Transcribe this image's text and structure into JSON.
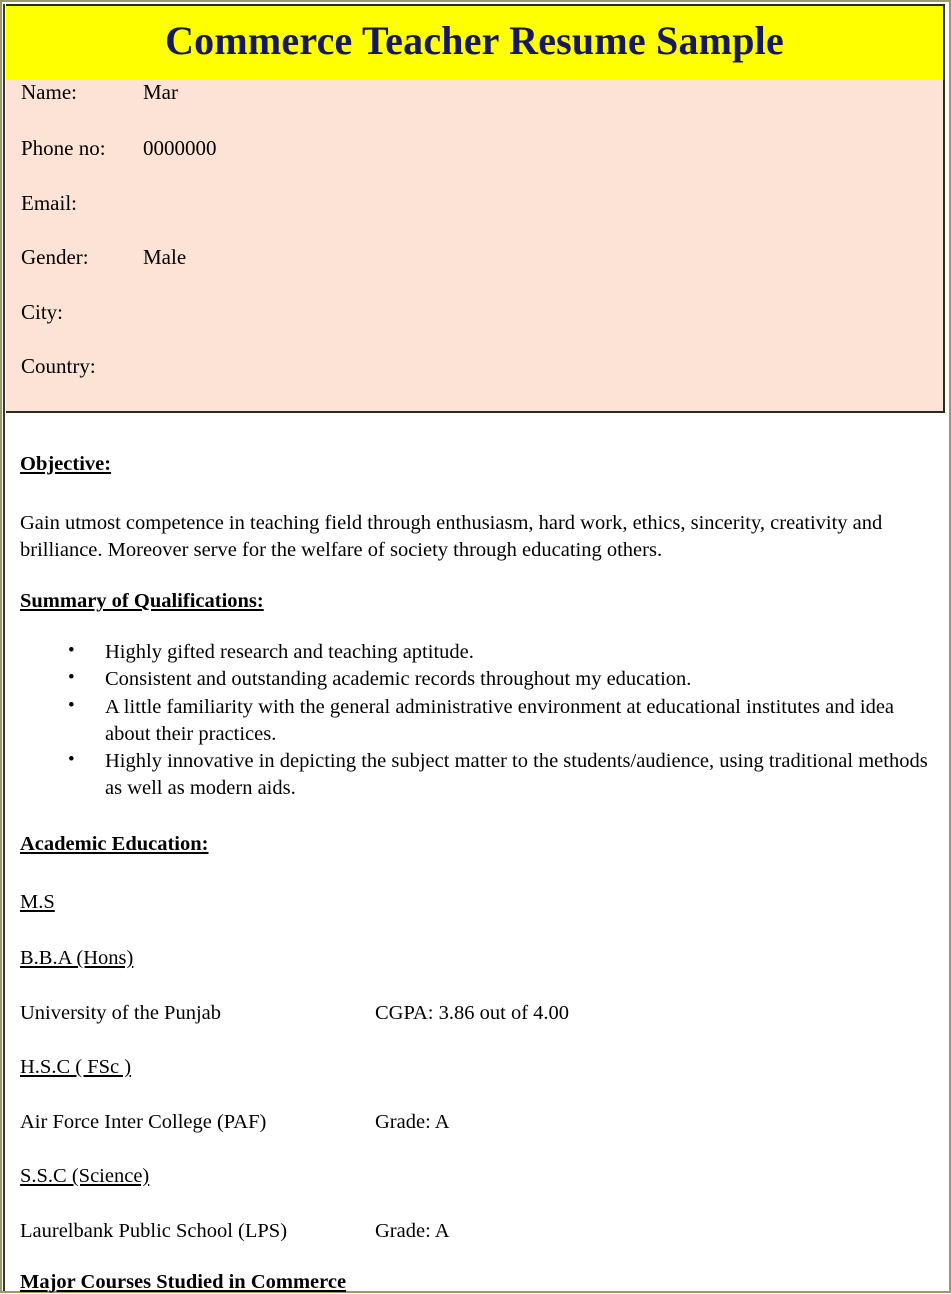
{
  "document": {
    "title": "Commerce Teacher Resume Sample",
    "colors": {
      "title_banner_bg": "#ffff00",
      "title_text": "#16195c",
      "info_block_bg": "#fce3d5",
      "page_border": "#9a9a6b",
      "body_text": "#000000"
    }
  },
  "personal_info": {
    "rows": [
      {
        "label": "Name:",
        "value": "Mar"
      },
      {
        "label": "Phone no:",
        "value": "0000000"
      },
      {
        "label": "Email:",
        "value": ""
      },
      {
        "label": "Gender:",
        "value": "Male"
      },
      {
        "label": "City:",
        "value": ""
      },
      {
        "label": "Country:",
        "value": ""
      }
    ]
  },
  "objective": {
    "heading": "Objective:",
    "text": "Gain utmost competence in teaching field through enthusiasm, hard work, ethics, sincerity, creativity and brilliance. Moreover serve for the welfare of society through educating others."
  },
  "summary": {
    "heading": "Summary of Qualifications:",
    "bullets": [
      "Highly gifted research and teaching aptitude.",
      "Consistent and outstanding academic records throughout my education.",
      "A little familiarity with the general administrative environment at educational institutes and idea about their practices.",
      "Highly innovative in depicting the subject matter to the students/audience, using traditional methods as well as modern aids."
    ]
  },
  "education": {
    "heading": "Academic Education:",
    "entries": [
      {
        "degree": "M.S",
        "school": "",
        "result": ""
      },
      {
        "degree": "B.B.A (Hons)",
        "school": "University of the Punjab",
        "result": "CGPA: 3.86 out of 4.00"
      },
      {
        "degree": "H.S.C ( FSc )",
        "school": "Air Force Inter College (PAF)",
        "result": "Grade: A"
      },
      {
        "degree": "S.S.C (Science)",
        "school": "Laurelbank Public School (LPS)",
        "result": "Grade: A"
      }
    ]
  },
  "courses": {
    "heading": "Major Courses Studied in Commerce"
  }
}
